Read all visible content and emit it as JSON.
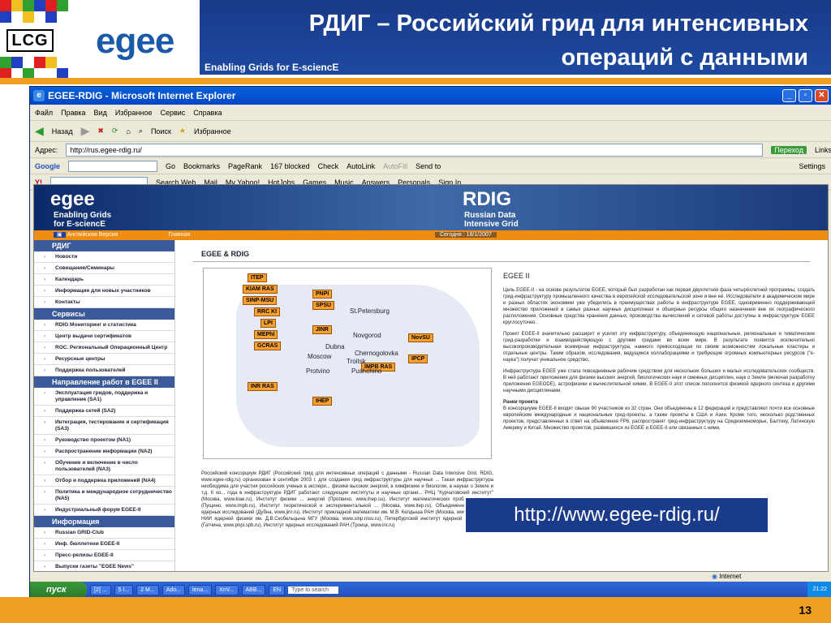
{
  "slide": {
    "title": "РДИГ – Российский грид для интенсивных операций с данными",
    "tagline": "Enabling Grids for E-sciencE",
    "lcg_logo": "LCG",
    "egee_logo": "egee",
    "page_number": "13",
    "url_callout": "http://www.egee-rdig.ru/"
  },
  "browser": {
    "window_title": "EGEE-RDIG - Microsoft Internet Explorer",
    "menu": [
      "Файл",
      "Правка",
      "Вид",
      "Избранное",
      "Сервис",
      "Справка"
    ],
    "toolbar": [
      "Назад",
      "Поиск",
      "Избранное"
    ],
    "address_label": "Адрес:",
    "address": "http://rus.egee-rdig.ru/",
    "go_label": "Переход",
    "links_label": "Links",
    "google_bar": [
      "Google",
      "Go",
      "Bookmarks",
      "PageRank",
      "167 blocked",
      "Check",
      "AutoLink",
      "AutoFill",
      "Send to",
      "Settings"
    ],
    "yahoo_bar": [
      "Y!",
      "Search Web",
      "Mail",
      "My Yahoo!",
      "HotJobs",
      "Games",
      "Music",
      "Answers",
      "Personals",
      "Sign In"
    ],
    "status_text": "Internet"
  },
  "site": {
    "egee": "egee",
    "egee_sub1": "Enabling Grids",
    "egee_sub2": "for E-sciencE",
    "rdig": "RDIG",
    "rdig_sub1": "Russian Data",
    "rdig_sub2": "Intensive Grid",
    "strip_eng": "Английская Версия",
    "strip_home": "Главная",
    "strip_date": "Сегодня : 18/1/2007",
    "nav_sections": [
      {
        "head": "РДИГ",
        "items": [
          "Новости",
          "Совещания/Семинары",
          "Календарь",
          "Информация для новых участников",
          "Контакты"
        ]
      },
      {
        "head": "Сервисы",
        "items": [
          "RDIG Мониторинг и статистика",
          "Центр выдачи сертификатов",
          "ROC. Региональный Операционный Центр",
          "Ресурсные центры",
          "Поддержка пользователей"
        ]
      },
      {
        "head": "Направление работ в EGEE II",
        "items": [
          "Эксплуатация гридов, поддержка и управление (SA1)",
          "Поддержка сетей (SA2)",
          "Интеграция, тестирование и сертификация (SA3)",
          "Руководство проектом (NA1)",
          "Распространение информации (NA2)",
          "Обучение и включение в число пользователей (NA3)",
          "Отбор и поддержка приложений (NA4)",
          "Политика и международное сотрудничество (NA5)",
          "Индустриальный форум EGEE-II"
        ]
      },
      {
        "head": "Информация",
        "items": [
          "Russian GRID-Club",
          "Инф. бюллетени EGEE-II",
          "Пресс-релизы EGEE-II",
          "Выпуски газеты \"EGEE News\""
        ]
      }
    ],
    "content_title": "EGEE & RDIG",
    "map_labels": [
      "ITEP",
      "KIAM RAS",
      "SINP-MSU",
      "RRC KI",
      "LPI",
      "MEPhI",
      "GCRAS",
      "INR RAS",
      "PNPI",
      "SPSU",
      "JINR",
      "NovSU",
      "IPCP",
      "IMPB RAS",
      "IHEP"
    ],
    "cities": [
      "St.Petersburg",
      "Novgorod",
      "Dubna",
      "Chernogolovka",
      "Moscow",
      "Troitsk",
      "Protvino",
      "Pushchino"
    ],
    "right_title": "EGEE II",
    "right_p1": "Цель EGEE-II - на основе результатов EGEE, который был разработан как первая двухлетняя фаза четырёхлетней программы, создать грид-инфраструктуру промышленного качества в европейской исследовательской зоне и вне её. Исследователи в академическом мире и разных областях экономики уже убедились в преимуществах работы в инфраструктуре EGEE, одновременно поддерживающей множество приложений в самых разных научных дисциплинах и обширные ресурсы общего назначения вне их географического расположения. Основные средства хранения данных, производства вычислений и сетевой работы доступны в инфраструктуре EGEE круглосуточно.",
    "right_p2": "Проект EGEE-II значительно расширит и усилит эту инфраструктуру, объединяющую национальные, региональные и тематические грид-разработки и взаимодействующую с другими гридами во всем мире. В результате появится исключительно высокопроизводительная всемирная инфраструктура, намного превосходящая по своим возможностям локальные кластеры и отдельные центры. Таким образом, исследования, ведущиеся коллаборациями и требующие огромных компьютерных ресурсов (\"е-наука\") получат уникальное средство.",
    "right_p3": "Инфраструктура EGEE уже стала повседневным рабочим средством для нескольких больших и малых исследовательских сообществ. В ней работают приложения для физики высоких энергий, биологических наук и смежных дисциплин, наук о Земле (включая разработку приложения EGEODE), астрофизики и вычислительной химии. В EGEE-II этот список пополнится физикой ядерного синтеза и другими научными дисциплинами.",
    "right_h2": "Ранки проекта",
    "right_p4": "В консорциуме EGEE-II входят свыше 90 участников из 32 стран. Они объединены в 12 федераций и представляют почти все основные европейские международные и национальные грид-проекты, а также проекты в США и Азии. Кроме того, несколько родственных проектов, представленных в ответ на объявления FP6, распространят грид-инфраструктуру на Средиземноморье, Балтику, Латинскую Америку и Китай. Множество проектов, развившихся из EGEE и EGEE-II или связанных с ними,",
    "below_map": "Российский консорциум РДИГ (Российский грид для интенсивных операций с данными - Russian Data Intensive Grid, RDIG, www.egee-rdig.ru) организован в сентябре 2003 г. для создания грид инфраструктуры для научных ... Такая инфраструктура необходима для участия российских ученых в экспери... физике высоких энергий, в химфизике и биологии, в науках о Земле и т.д. К ко... года в инфраструктуре РДИГ работают следующие институты и научные органи... РНЦ \"Курчатовский институт\" (Москва, www.kiae.ru), Институт физики ... энергий (Протвино, www.ihep.su), Институт математических проблем биоло... (Пущино, www.impb.ru), Институт теоретической и экспериментальной ... (Москва, www.itep.ru), Объединенный институт ядерных исследований (Дубна, www.jinr.ru), Институт прикладной математики им. М.В. Келдыша РАН (Москва, www.keldysh.ru), НИИ ядерной физики им. Д.В.Скобельцына МГУ (Москва, www.sinp.msu.ru), Петербургский институт ядерной физики РАН (Гатчина, www.pnpi.spb.ru), Институт ядерных исследований РАН (Троицк, www.inr.ru)"
  },
  "taskbar": {
    "start": "пуск",
    "tasks": [
      "[2] ...",
      "5 I...",
      "2 M...",
      "Ado...",
      "lena...",
      "XnV...",
      "ABB...",
      "EN",
      "Type to search"
    ],
    "time": "21:22"
  },
  "colors": {
    "banner": "#1a3a8a",
    "orange": "#f0a020",
    "accent": "#1a5aa8"
  }
}
